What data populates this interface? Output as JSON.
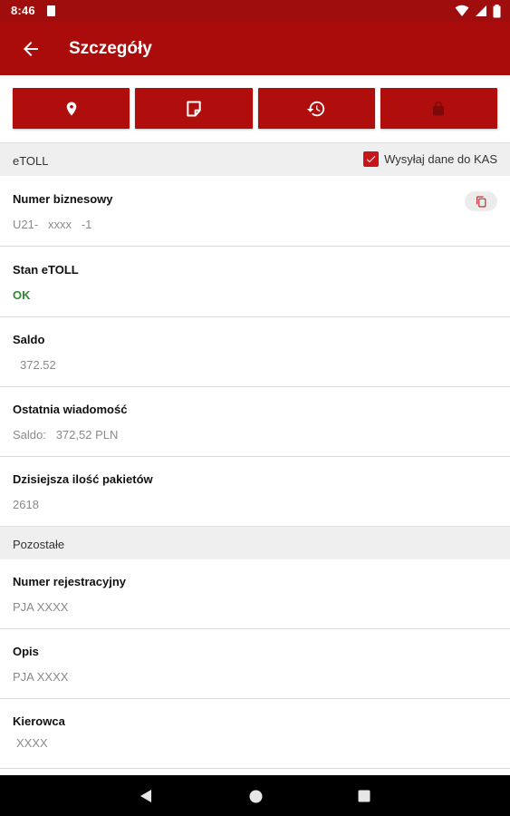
{
  "status_bar": {
    "time": "8:46"
  },
  "app_bar": {
    "title": "Szczegóły"
  },
  "action_buttons": [
    {
      "icon": "location-pin-icon"
    },
    {
      "icon": "note-icon"
    },
    {
      "icon": "history-icon"
    },
    {
      "icon": "lock-icon"
    }
  ],
  "etoll_section": {
    "title": "eTOLL",
    "send_to_kas": {
      "label": "Wysyłaj dane do KAS",
      "checked": true
    }
  },
  "fields": {
    "business_number": {
      "label": "Numer biznesowy",
      "value": "U21-   xxxx   -1"
    },
    "etoll_state": {
      "label": "Stan eTOLL",
      "value": "OK"
    },
    "balance": {
      "label": "Saldo",
      "value": "372.52"
    },
    "last_message": {
      "label": "Ostatnia wiadomość",
      "value": "Saldo:   372,52 PLN"
    },
    "packets_today": {
      "label": "Dzisiejsza ilość pakietów",
      "value": "2618"
    }
  },
  "other_section": {
    "title": "Pozostałe"
  },
  "other_fields": {
    "registration": {
      "label": "Numer rejestracyjny",
      "value": "PJA XXXX"
    },
    "description": {
      "label": "Opis",
      "value": "PJA XXXX"
    },
    "driver": {
      "label": "Kierowca",
      "value": "XXXX"
    }
  },
  "colors": {
    "primary": "#aa0b0b",
    "status_bar": "#9f0d0d",
    "ok": "#2e8b2e",
    "section_bg": "#efefef"
  }
}
